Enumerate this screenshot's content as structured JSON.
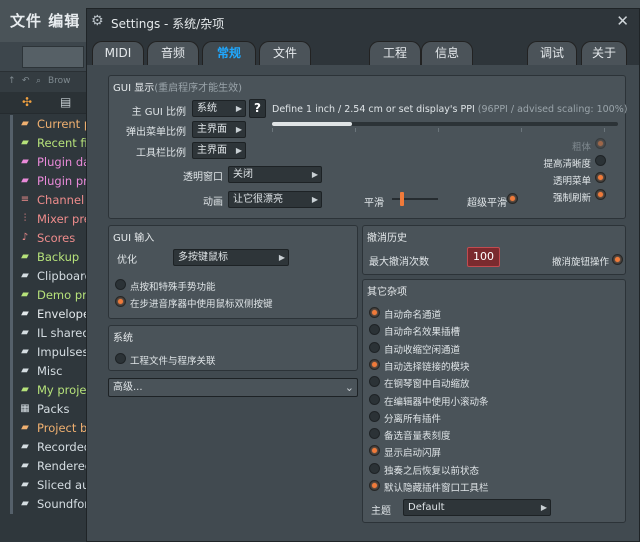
{
  "background_app": {
    "title": "文件 编辑",
    "browser_header_label": "Brow",
    "browser_items": [
      {
        "label": "Current p",
        "color": "#f0b070",
        "icon": "folder-icon"
      },
      {
        "label": "Recent fi",
        "color": "#b6e27a",
        "icon": "folder-icon"
      },
      {
        "label": "Plugin da",
        "color": "#e98ad9",
        "icon": "folder-icon"
      },
      {
        "label": "Plugin pr",
        "color": "#e98ad9",
        "icon": "folder-icon"
      },
      {
        "label": "Channel",
        "color": "#ee8c8c",
        "icon": "channel-icon"
      },
      {
        "label": "Mixer pre",
        "color": "#ee8c8c",
        "icon": "mixer-icon"
      },
      {
        "label": "Scores",
        "color": "#ee8c8c",
        "icon": "note-icon"
      },
      {
        "label": "Backup",
        "color": "#b6e27a",
        "icon": "folder-icon"
      },
      {
        "label": "Clipboard",
        "color": "#d5dde2",
        "icon": "folder-icon"
      },
      {
        "label": "Demo pro",
        "color": "#b6e27a",
        "icon": "folder-icon"
      },
      {
        "label": "Envelope",
        "color": "#e3e8eb",
        "icon": "folder-icon"
      },
      {
        "label": "IL shared",
        "color": "#d5dde2",
        "icon": "folder-icon"
      },
      {
        "label": "Impulses",
        "color": "#d5dde2",
        "icon": "folder-icon"
      },
      {
        "label": "Misc",
        "color": "#d5dde2",
        "icon": "folder-icon"
      },
      {
        "label": "My proje",
        "color": "#b6e27a",
        "icon": "folder-icon"
      },
      {
        "label": "Packs",
        "color": "#d5dde2",
        "icon": "packs-icon"
      },
      {
        "label": "Project b",
        "color": "#f0b070",
        "icon": "folder-icon"
      },
      {
        "label": "Recorded",
        "color": "#d5dde2",
        "icon": "folder-icon"
      },
      {
        "label": "Rendered",
        "color": "#d5dde2",
        "icon": "folder-icon"
      },
      {
        "label": "Sliced au",
        "color": "#d5dde2",
        "icon": "folder-icon"
      },
      {
        "label": "Soundfor",
        "color": "#d5dde2",
        "icon": "folder-icon"
      }
    ]
  },
  "window": {
    "title": "Settings - 系统/杂项",
    "close": "✕"
  },
  "tabs": [
    {
      "label": "MIDI",
      "active": false
    },
    {
      "label": "音频",
      "active": false
    },
    {
      "label": "常规",
      "active": true
    },
    {
      "label": "文件",
      "active": false
    },
    {
      "label": "工程",
      "active": false
    },
    {
      "label": "信息",
      "active": false
    },
    {
      "label": "调试",
      "active": false
    },
    {
      "label": "关于",
      "active": false
    }
  ],
  "gui_display": {
    "title": "GUI 显示",
    "subtitle": "(重启程序才能生效)",
    "main_scale_label": "主 GUI 比例",
    "main_scale_value": "系统",
    "help": "?",
    "ppi_text": "Define 1 inch / 2.54 cm or set display's PPI",
    "ppi_hint": "(96PPI / advised scaling: 100%)",
    "popup_scale_label": "弹出菜单比例",
    "popup_scale_value": "主界面",
    "toolbar_scale_label": "工具栏比例",
    "toolbar_scale_value": "主界面",
    "transparent_label": "透明窗口",
    "transparent_value": "关闭",
    "animation_label": "动画",
    "animation_value": "让它很漂亮",
    "smooth_label": "平滑",
    "super_smooth_label": "超级平滑",
    "super_smooth_on": true,
    "right_options": [
      {
        "label": "粗体",
        "on": true,
        "dim": true
      },
      {
        "label": "提高清晰度",
        "on": false,
        "dim": false
      },
      {
        "label": "透明菜单",
        "on": true,
        "dim": false
      },
      {
        "label": "强制刷新",
        "on": true,
        "dim": false
      }
    ]
  },
  "gui_input": {
    "title": "GUI 输入",
    "optimize_label": "优化",
    "optimize_value": "多按键鼠标",
    "options": [
      {
        "label": "点按和特殊手势功能",
        "on": false
      },
      {
        "label": "在步进音序器中使用鼠标双侧按键",
        "on": true
      }
    ]
  },
  "undo_history": {
    "title": "撤消历史",
    "max_label": "最大撤消次数",
    "max_value": "100",
    "knob_undo_label": "撤消旋钮操作",
    "knob_undo_on": true
  },
  "system": {
    "title": "系统",
    "options": [
      {
        "label": "工程文件与程序关联",
        "on": false
      }
    ]
  },
  "advanced": {
    "label": "高级..."
  },
  "misc": {
    "title": "其它杂项",
    "options": [
      {
        "label": "自动命名通道",
        "on": true
      },
      {
        "label": "自动命名效果插槽",
        "on": false
      },
      {
        "label": "自动收缩空闲通道",
        "on": false
      },
      {
        "label": "自动选择链接的模块",
        "on": true
      },
      {
        "label": "在钢琴窗中自动缩放",
        "on": false
      },
      {
        "label": "在编辑器中使用小滚动条",
        "on": false
      },
      {
        "label": "分离所有插件",
        "on": false
      },
      {
        "label": "备选音量表刻度",
        "on": false
      },
      {
        "label": "显示启动闪屏",
        "on": true
      },
      {
        "label": "独奏之后恢复以前状态",
        "on": false
      },
      {
        "label": "默认隐藏插件窗口工具栏",
        "on": true
      }
    ],
    "theme_label": "主题",
    "theme_value": "Default"
  }
}
